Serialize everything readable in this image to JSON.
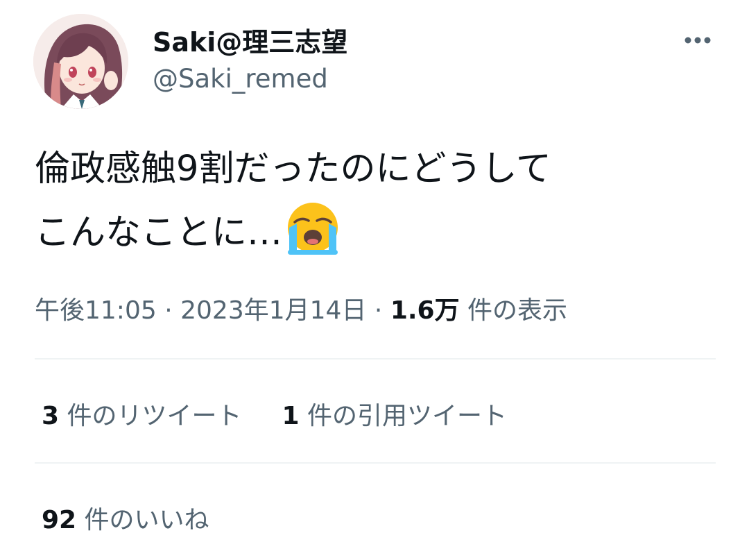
{
  "user": {
    "display_name": "Saki@理三志望",
    "handle": "@Saki_remed"
  },
  "tweet": {
    "text_line1": "倫政感触9割だったのにどうして",
    "text_line2": "こんなことに…",
    "emoji": "loudly-crying-face"
  },
  "meta": {
    "time": "午後11:05",
    "sep1": "·",
    "date": "2023年1月14日",
    "sep2": "·",
    "views_count": "1.6万",
    "views_label": " 件の表示"
  },
  "stats": {
    "retweets_count": "3",
    "retweets_label": " 件のリツイート",
    "quotes_count": "1",
    "quotes_label": " 件の引用ツイート",
    "likes_count": "92",
    "likes_label": " 件のいいね"
  },
  "colors": {
    "primary_text": "#0f1419",
    "secondary_text": "#536471",
    "divider": "#eff3f4"
  }
}
